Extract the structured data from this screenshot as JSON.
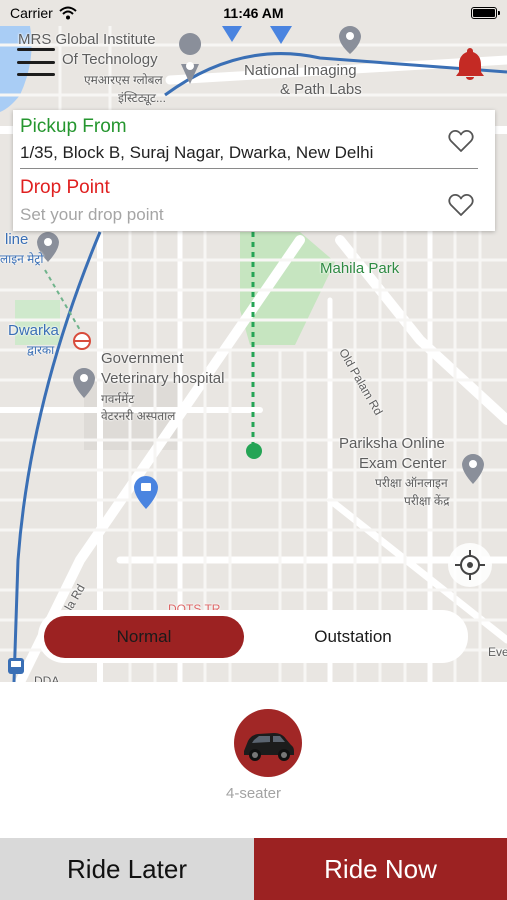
{
  "status_bar": {
    "carrier": "Carrier",
    "time": "11:46 AM"
  },
  "map": {
    "labels": {
      "mrs_line1": "MRS Global Institute",
      "mrs_line2": "Of Technology",
      "mrs_hindi1": "एमआरएस ग्लोबल",
      "mrs_hindi2": "इंस्टिट्यूट...",
      "lab_line1": "National Imaging",
      "lab_line2": "& Path Labs",
      "line": "line",
      "line_hindi": "लाइन मेट्रो",
      "dwarka": "Dwarka",
      "dwarka_hindi": "द्वारका",
      "govt_line1": "Government",
      "govt_line2": "Veterinary hospital",
      "govt_hindi1": "गवर्नमेंट",
      "govt_hindi2": "वेटरनरी अस्पताल",
      "mahila_park": "Mahila Park",
      "old_palam": "Old Palam Rd",
      "pariksha_line1": "Pariksha Online",
      "pariksha_line2": "Exam Center",
      "pariksha_hindi1": "परीक्षा ऑनलाइन",
      "pariksha_hindi2": "परीक्षा केंद्र",
      "la_rd": "la Rd",
      "dots": "DOTS TR...",
      "dda": "DDA",
      "eve": "Eve"
    },
    "icons": [
      "hamburger-menu-icon",
      "bell-icon",
      "heart-icon",
      "locate-icon",
      "map-pin-icon",
      "metro-icon",
      "shopping-bag-icon"
    ]
  },
  "address_card": {
    "pickup_title": "Pickup From",
    "pickup_address": "1/35, Block B, Suraj Nagar, Dwarka, New Delhi",
    "drop_title": "Drop Point",
    "drop_placeholder": "Set your drop point",
    "drop_value": ""
  },
  "trip_type": {
    "options": [
      "Normal",
      "Outstation"
    ],
    "selected": "Normal"
  },
  "vehicle": {
    "label": "4-seater"
  },
  "actions": {
    "ride_later": "Ride Later",
    "ride_now": "Ride Now"
  },
  "colors": {
    "brand": "#9c2222",
    "pickup": "#25962f",
    "drop": "#e02020"
  }
}
